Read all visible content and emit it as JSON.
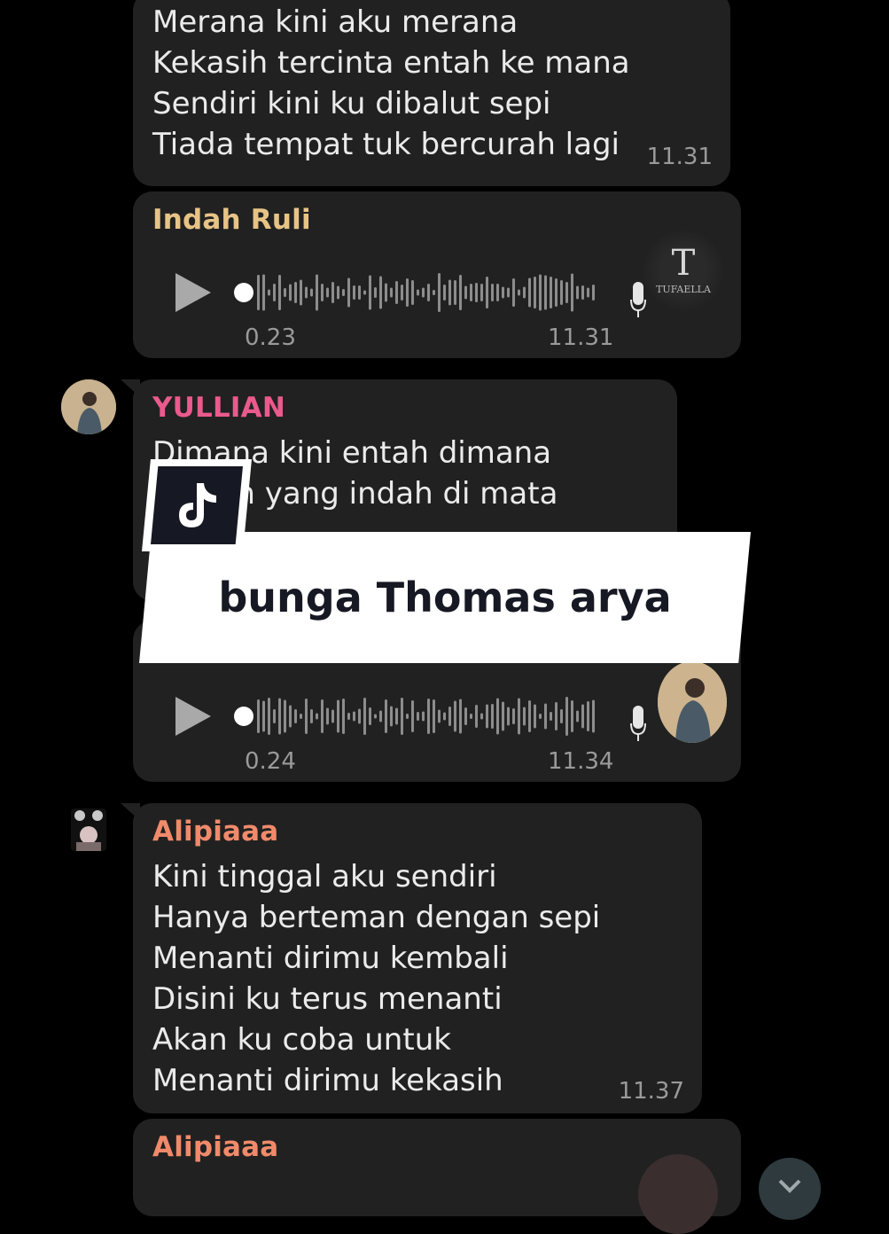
{
  "messages": [
    {
      "lines": "Merana kini aku merana\nKekasih tercinta entah ke mana\nSendiri kini ku dibalut sepi\nTiada tempat tuk bercurah lagi",
      "time": "11.31"
    },
    {
      "sender": "Indah Ruli",
      "voice_duration": "0.23",
      "time": "11.31",
      "sender_color": "#e7c486",
      "watermark_text": "TUFAELLA"
    },
    {
      "sender": "YULLIAN",
      "lines": "Dimana kini entah dimana\nimpian yang indah di mata",
      "sender_color": "#ea5a8c"
    },
    {
      "voice_duration": "0.24",
      "time": "11.34"
    },
    {
      "sender": "Alipiaaa",
      "lines": "Kini tinggal aku sendiri\nHanya berteman dengan sepi\nMenanti dirimu kembali\nDisini ku terus menanti\nAkan ku coba untuk\nMenanti dirimu kekasih",
      "time": "11.37",
      "sender_color": "#f08a6a"
    },
    {
      "sender": "Alipiaaa"
    }
  ],
  "overlay": {
    "caption": "bunga Thomas arya",
    "logo": "tiktok-logo-icon"
  },
  "colors": {
    "bubble": "#212121",
    "background": "#000000",
    "time": "#9a9a9a"
  }
}
